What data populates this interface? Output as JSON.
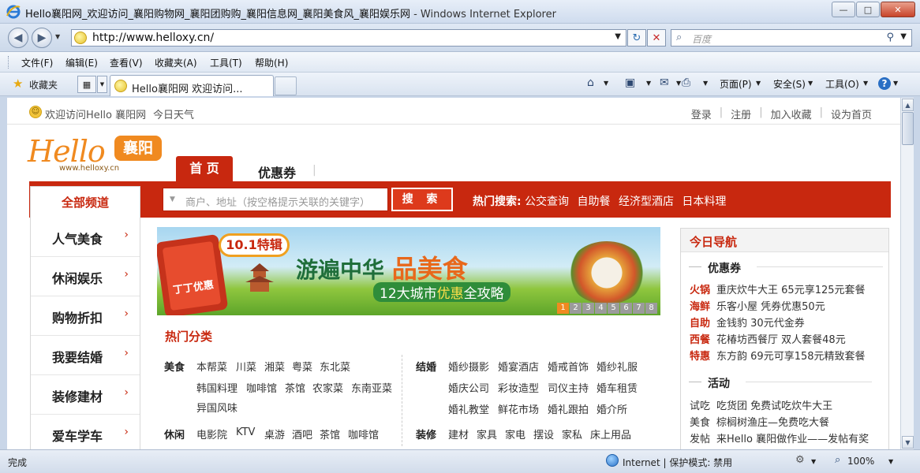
{
  "window": {
    "title": "Hello襄阳网_欢迎访问_襄阳购物网_襄阳团购购_襄阳信息网_襄阳美食风_襄阳娱乐网",
    "title_suffix": "- Windows Internet Explorer",
    "controls": {
      "minimize": "—",
      "maximize": "□",
      "close": "✕"
    }
  },
  "address_bar": {
    "url": "http://www.helloxy.cn/",
    "search_placeholder": "百度",
    "back": "◀",
    "forward": "▶",
    "refresh": "↻",
    "stop": "✕"
  },
  "menu": {
    "items": [
      "文件(F)",
      "编辑(E)",
      "查看(V)",
      "收藏夹(A)",
      "工具(T)",
      "帮助(H)"
    ]
  },
  "favorites_bar": {
    "favorites_label": "收藏夹",
    "tab_title": "Hello襄阳网  欢迎访问...",
    "commands": {
      "page": "页面(P)",
      "safety": "安全(S)",
      "tools": "工具(O)",
      "help": "?"
    }
  },
  "page": {
    "topbar": {
      "welcome": "欢迎访问Hello 襄阳网",
      "weather": "今日天气",
      "links": [
        "登录",
        "注册",
        "加入收藏",
        "设为首页"
      ]
    },
    "logo": {
      "text": "Hello",
      "city": "襄阳",
      "url": "www.helloxy.cn"
    },
    "nav": {
      "home": "首 页",
      "coupon": "优惠券",
      "sep": "|"
    },
    "all_channels": "全部频道",
    "search": {
      "placeholder": "商户、地址（按空格提示关联的关键字）",
      "button": "搜 索"
    },
    "hot_search": {
      "label": "热门搜索:",
      "terms": [
        "公交查询",
        "自助餐",
        "经济型酒店",
        "日本料理"
      ]
    },
    "channels": [
      "人气美食",
      "休闲娱乐",
      "购物折扣",
      "我要结婚",
      "装修建材",
      "爱车学车"
    ],
    "banner": {
      "special": "10.1特辑",
      "headline_a": "游遍中华",
      "headline_b": "品美食",
      "sub_a": "12大城市",
      "sub_b": "优惠",
      "sub_c": "全攻略",
      "app_name": "丁丁优惠",
      "pages": [
        "1",
        "2",
        "3",
        "4",
        "5",
        "6",
        "7",
        "8"
      ]
    },
    "hot_categories": {
      "title": "热门分类",
      "food": {
        "head": "美食",
        "row1": [
          "本帮菜",
          "川菜",
          "湘菜",
          "粤菜",
          "东北菜"
        ],
        "row2": [
          "韩国料理",
          "咖啡馆",
          "茶馆",
          "农家菜",
          "东南亚菜"
        ],
        "row3": [
          "异国风味"
        ]
      },
      "wedding": {
        "head": "结婚",
        "row1": [
          "婚纱摄影",
          "婚宴酒店",
          "婚戒首饰",
          "婚纱礼服"
        ],
        "row2": [
          "婚庆公司",
          "彩妆造型",
          "司仪主持",
          "婚车租赁"
        ],
        "row3": [
          "婚礼教堂",
          "鲜花市场",
          "婚礼跟拍",
          "婚介所"
        ]
      },
      "leisure": {
        "head": "休闲",
        "row1": [
          "电影院",
          "KTV",
          "桌游",
          "酒吧",
          "茶馆",
          "咖啡馆"
        ]
      },
      "decor": {
        "head": "装修",
        "row1": [
          "建材",
          "家具",
          "家电",
          "摆设",
          "家私",
          "床上用品"
        ]
      }
    },
    "today_nav": {
      "title": "今日导航",
      "coupon_head": "优惠券",
      "coupons": [
        {
          "tag": "火锅",
          "text": "重庆炊牛大王 65元享125元套餐"
        },
        {
          "tag": "海鲜",
          "text": "乐客小屋 凭券优惠50元"
        },
        {
          "tag": "自助",
          "text": "金钱豹 30元代金券"
        },
        {
          "tag": "西餐",
          "text": "花椿坊西餐厅 双人套餐48元"
        },
        {
          "tag": "特惠",
          "text": "东方韵 69元可享158元精致套餐"
        }
      ],
      "activity_head": "活动",
      "activities": [
        {
          "tag": "试吃",
          "text": "吃货团 免费试吃炊牛大王"
        },
        {
          "tag": "美食",
          "text": "棕榈树渔庄—免费吃大餐"
        },
        {
          "tag": "发帖",
          "text": "来Hello 襄阳做作业——发帖有奖"
        }
      ]
    }
  },
  "status_bar": {
    "status": "完成",
    "zone": "Internet | 保护模式: 禁用",
    "zoom": "100%"
  }
}
